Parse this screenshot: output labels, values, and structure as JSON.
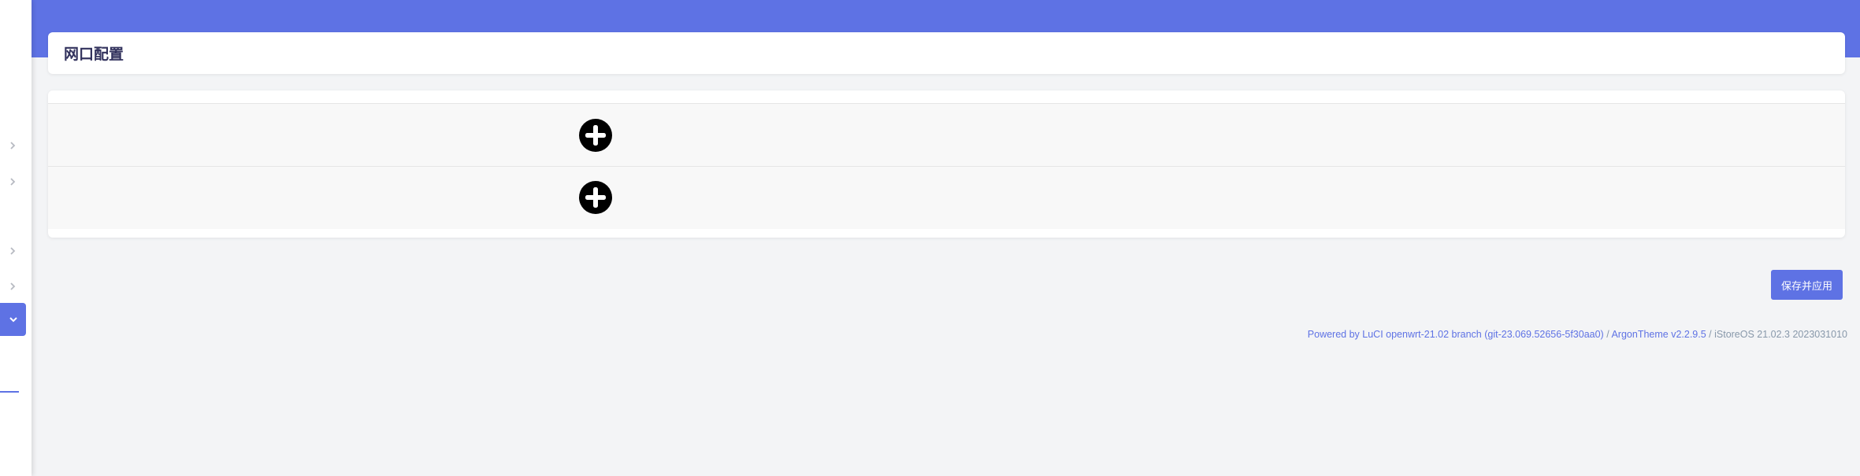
{
  "page": {
    "title": "网口配置"
  },
  "sidebar": {
    "icons": [
      "chevron-right-icon",
      "chevron-right-icon",
      "chevron-right-icon",
      "chevron-right-icon",
      "chevron-down-icon"
    ]
  },
  "table": {
    "rows": [
      {
        "action_icon": "add-circle-icon"
      },
      {
        "action_icon": "add-circle-icon"
      }
    ]
  },
  "actions": {
    "save_apply_label": "保存并应用"
  },
  "footer": {
    "luci_link": "Powered by LuCI openwrt-21.02 branch (git-23.069.52656-5f30aa0)",
    "separator1": " / ",
    "theme_link": "ArgonTheme v2.2.9.5",
    "separator2": " / ",
    "os_version": "iStoreOS 21.02.3 2023031010"
  },
  "colors": {
    "accent": "#5e72e4",
    "background": "#f3f4f6",
    "title_text": "#32325d"
  }
}
